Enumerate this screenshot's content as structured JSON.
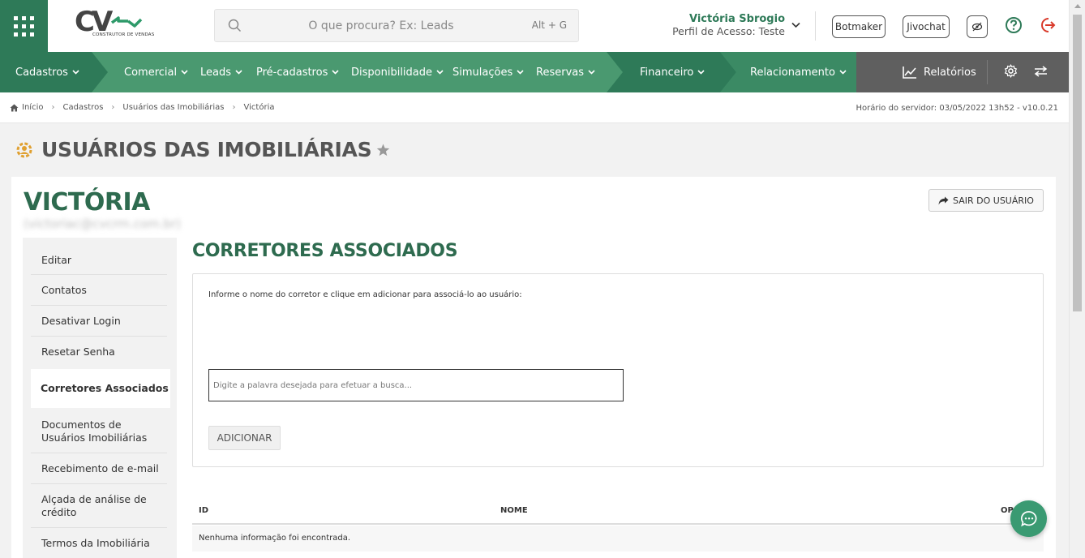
{
  "colors": {
    "brand_green": "#2e7a58",
    "nav_green": "#4a9970",
    "nav_dark": "#5f5f5f",
    "title_green": "#2e6b4f"
  },
  "logo": {
    "letters": "CV",
    "tagline": "CONSTRUTOR DE VENDAS"
  },
  "search": {
    "placeholder": "O que procura? Ex: Leads",
    "shortcut": "Alt + G"
  },
  "user": {
    "name": "Victória Sbrogio",
    "profile": "Perfil de Acesso: Teste"
  },
  "top_buttons": {
    "botmaker": "Botmaker",
    "jivochat": "Jivochat"
  },
  "top_icons": [
    "eye-slash-icon",
    "help-icon",
    "logout-icon"
  ],
  "nav": {
    "items": [
      {
        "label": "Cadastros"
      },
      {
        "label": "Comercial"
      },
      {
        "label": "Leads"
      },
      {
        "label": "Pré-cadastros"
      },
      {
        "label": "Disponibilidade"
      },
      {
        "label": "Simulações"
      },
      {
        "label": "Reservas"
      },
      {
        "label": "Financeiro"
      },
      {
        "label": "Relacionamento"
      }
    ],
    "reports": "Relatórios"
  },
  "breadcrumb": {
    "items": [
      "Início",
      "Cadastros",
      "Usuários das Imobiliárias",
      "Victória"
    ],
    "server_time": "Horário do servidor: 03/05/2022 13h52 - v10.0.21"
  },
  "page": {
    "title": "USUÁRIOS DAS IMOBILIÁRIAS"
  },
  "profile": {
    "name": "VICTÓRIA",
    "email": "(victoriac@cvcrm.com.br)",
    "logout_button": "SAIR DO USUÁRIO"
  },
  "side_menu": {
    "items": [
      {
        "label": "Editar"
      },
      {
        "label": "Contatos"
      },
      {
        "label": "Desativar Login"
      },
      {
        "label": "Resetar Senha"
      },
      {
        "label": "Corretores Associados",
        "active": true
      },
      {
        "label": "Documentos de Usuários Imobiliárias"
      },
      {
        "label": "Recebimento de e-mail"
      },
      {
        "label": "Alçada de análise de crédito"
      },
      {
        "label": "Termos da Imobiliária"
      }
    ]
  },
  "section": {
    "title": "CORRETORES ASSOCIADOS",
    "hint": "Informe o nome do corretor e clique em adicionar para associá-lo ao usuário:",
    "input_placeholder": "Digite a palavra desejada para efetuar a busca...",
    "add_button": "ADICIONAR"
  },
  "table": {
    "columns": [
      "ID",
      "NOME",
      "OP"
    ],
    "empty_message": "Nenhuma informação foi encontrada."
  }
}
